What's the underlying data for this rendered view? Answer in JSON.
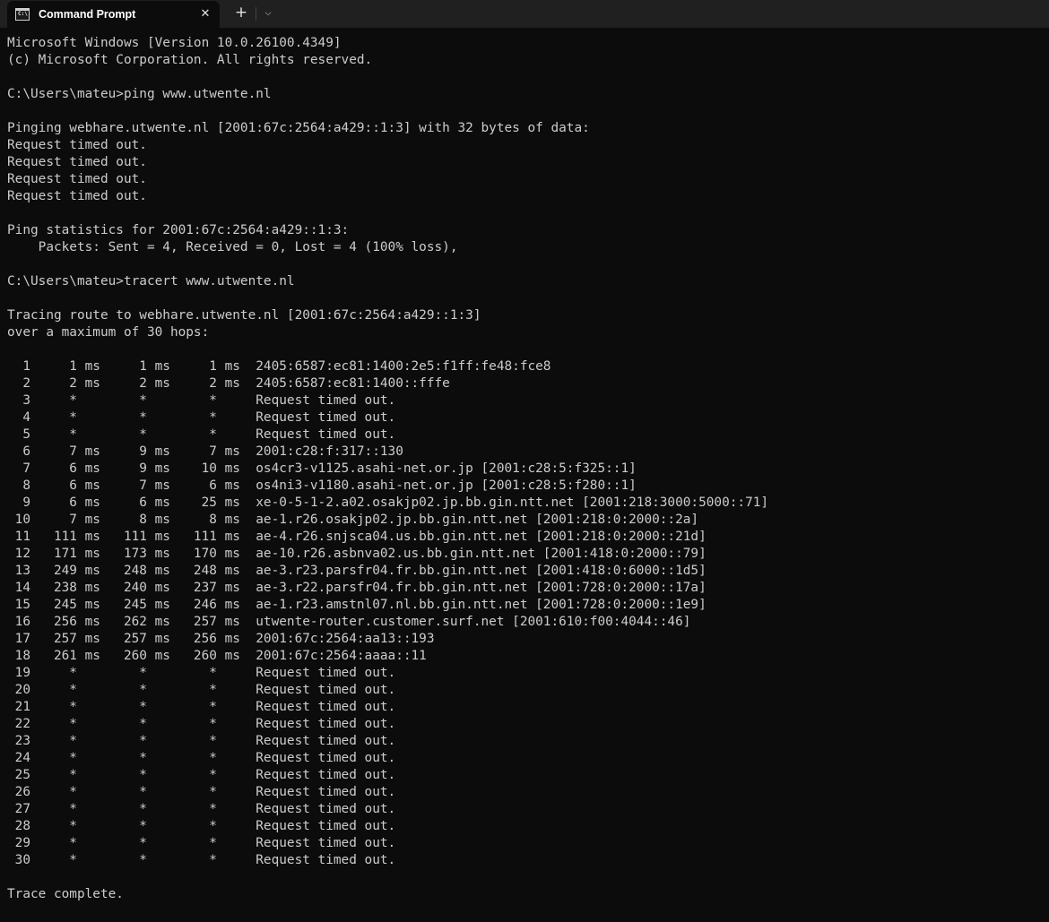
{
  "window": {
    "tab_title": "Command Prompt",
    "tab_icon_text": "C:\\",
    "close_glyph": "✕",
    "new_tab_glyph": "+",
    "dropdown_glyph": "⌵"
  },
  "console": {
    "lines": [
      "Microsoft Windows [Version 10.0.26100.4349]",
      "(c) Microsoft Corporation. All rights reserved.",
      "",
      "C:\\Users\\mateu>ping www.utwente.nl",
      "",
      "Pinging webhare.utwente.nl [2001:67c:2564:a429::1:3] with 32 bytes of data:",
      "Request timed out.",
      "Request timed out.",
      "Request timed out.",
      "Request timed out.",
      "",
      "Ping statistics for 2001:67c:2564:a429::1:3:",
      "    Packets: Sent = 4, Received = 0, Lost = 4 (100% loss),",
      "",
      "C:\\Users\\mateu>tracert www.utwente.nl",
      "",
      "Tracing route to webhare.utwente.nl [2001:67c:2564:a429::1:3]",
      "over a maximum of 30 hops:",
      "",
      "  1     1 ms     1 ms     1 ms  2405:6587:ec81:1400:2e5:f1ff:fe48:fce8",
      "  2     2 ms     2 ms     2 ms  2405:6587:ec81:1400::fffe",
      "  3     *        *        *     Request timed out.",
      "  4     *        *        *     Request timed out.",
      "  5     *        *        *     Request timed out.",
      "  6     7 ms     9 ms     7 ms  2001:c28:f:317::130",
      "  7     6 ms     9 ms    10 ms  os4cr3-v1125.asahi-net.or.jp [2001:c28:5:f325::1]",
      "  8     6 ms     7 ms     6 ms  os4ni3-v1180.asahi-net.or.jp [2001:c28:5:f280::1]",
      "  9     6 ms     6 ms    25 ms  xe-0-5-1-2.a02.osakjp02.jp.bb.gin.ntt.net [2001:218:3000:5000::71]",
      " 10     7 ms     8 ms     8 ms  ae-1.r26.osakjp02.jp.bb.gin.ntt.net [2001:218:0:2000::2a]",
      " 11   111 ms   111 ms   111 ms  ae-4.r26.snjsca04.us.bb.gin.ntt.net [2001:218:0:2000::21d]",
      " 12   171 ms   173 ms   170 ms  ae-10.r26.asbnva02.us.bb.gin.ntt.net [2001:418:0:2000::79]",
      " 13   249 ms   248 ms   248 ms  ae-3.r23.parsfr04.fr.bb.gin.ntt.net [2001:418:0:6000::1d5]",
      " 14   238 ms   240 ms   237 ms  ae-3.r22.parsfr04.fr.bb.gin.ntt.net [2001:728:0:2000::17a]",
      " 15   245 ms   245 ms   246 ms  ae-1.r23.amstnl07.nl.bb.gin.ntt.net [2001:728:0:2000::1e9]",
      " 16   256 ms   262 ms   257 ms  utwente-router.customer.surf.net [2001:610:f00:4044::46]",
      " 17   257 ms   257 ms   256 ms  2001:67c:2564:aa13::193",
      " 18   261 ms   260 ms   260 ms  2001:67c:2564:aaaa::11",
      " 19     *        *        *     Request timed out.",
      " 20     *        *        *     Request timed out.",
      " 21     *        *        *     Request timed out.",
      " 22     *        *        *     Request timed out.",
      " 23     *        *        *     Request timed out.",
      " 24     *        *        *     Request timed out.",
      " 25     *        *        *     Request timed out.",
      " 26     *        *        *     Request timed out.",
      " 27     *        *        *     Request timed out.",
      " 28     *        *        *     Request timed out.",
      " 29     *        *        *     Request timed out.",
      " 30     *        *        *     Request timed out.",
      "",
      "Trace complete."
    ]
  },
  "colors": {
    "background": "#0c0c0c",
    "tabbar": "#202020",
    "text": "#cccccc"
  }
}
